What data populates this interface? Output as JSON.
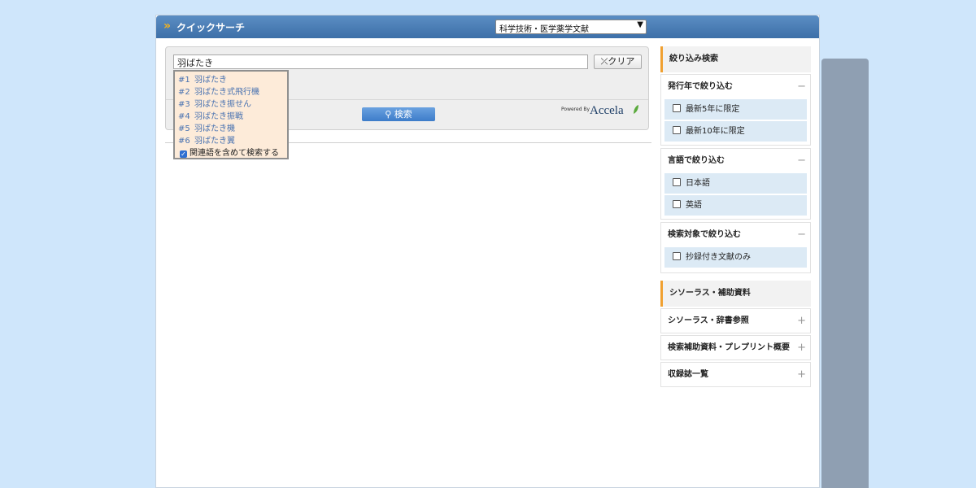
{
  "header": {
    "title": "クイックサーチ",
    "database_select": "科学技術・医学薬学文献"
  },
  "search": {
    "query": "羽ばたき",
    "clear_label": "クリア",
    "search_label": "検索",
    "powered_by": "Powered By",
    "brand": "Accela"
  },
  "suggestions": {
    "items": [
      {
        "num": "#1",
        "text": "羽ばたき"
      },
      {
        "num": "#2",
        "text": "羽ばたき式飛行機"
      },
      {
        "num": "#3",
        "text": "羽ばたき振せん"
      },
      {
        "num": "#4",
        "text": "羽ばたき振戦"
      },
      {
        "num": "#5",
        "text": "羽ばたき機"
      },
      {
        "num": "#6",
        "text": "羽ばたき翼"
      }
    ],
    "related_checkbox_label": "関連語を含めて検索する",
    "related_checked": true
  },
  "sidebar": {
    "refine_header": "絞り込み検索",
    "year_section": {
      "title": "発行年で絞り込む",
      "toggle": "−",
      "options": [
        "最新5年に限定",
        "最新10年に限定"
      ]
    },
    "language_section": {
      "title": "言語で絞り込む",
      "toggle": "−",
      "options": [
        "日本語",
        "英語"
      ]
    },
    "target_section": {
      "title": "検索対象で絞り込む",
      "toggle": "−",
      "options": [
        "抄録付き文献のみ"
      ]
    },
    "thesaurus_header": "シソーラス・補助資料",
    "links": [
      {
        "label": "シソーラス・辞書参照",
        "toggle": "+"
      },
      {
        "label": "検索補助資料・プレプリント概要",
        "toggle": "+"
      },
      {
        "label": "収録誌一覧",
        "toggle": "+"
      }
    ]
  },
  "colors": {
    "titlebar": "#3d6fa8",
    "accent": "#f0a030",
    "search_button": "#3d7cc9",
    "suggestion_text": "#4a73b1",
    "suggestion_bg": "#fdebd9",
    "option_bg": "#dceaf5"
  }
}
